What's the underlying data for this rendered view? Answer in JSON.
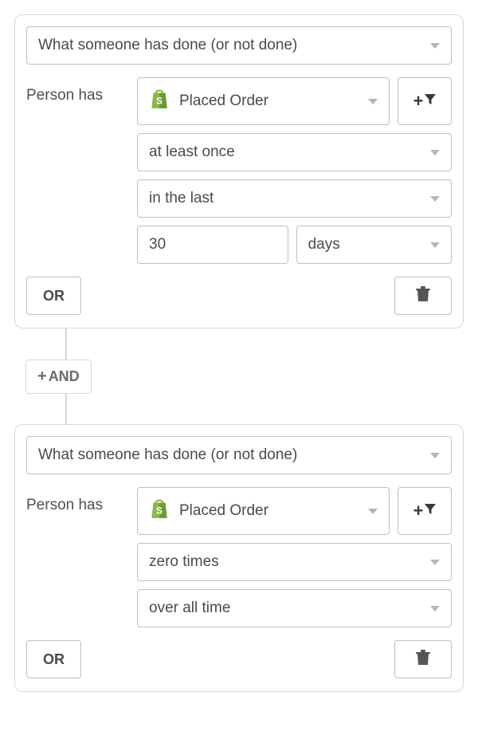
{
  "blocks": [
    {
      "type_label": "What someone has done (or not done)",
      "person_label": "Person has",
      "event_label": "Placed Order",
      "event_icon": "shopify-bag",
      "frequency_label": "at least once",
      "timeframe_label": "in the last",
      "amount_value": "30",
      "unit_label": "days",
      "show_amount_row": true,
      "or_label": "OR"
    },
    {
      "type_label": "What someone has done (or not done)",
      "person_label": "Person has",
      "event_label": "Placed Order",
      "event_icon": "shopify-bag",
      "frequency_label": "zero times",
      "timeframe_label": "over all time",
      "show_amount_row": false,
      "or_label": "OR"
    }
  ],
  "and_label": "AND"
}
